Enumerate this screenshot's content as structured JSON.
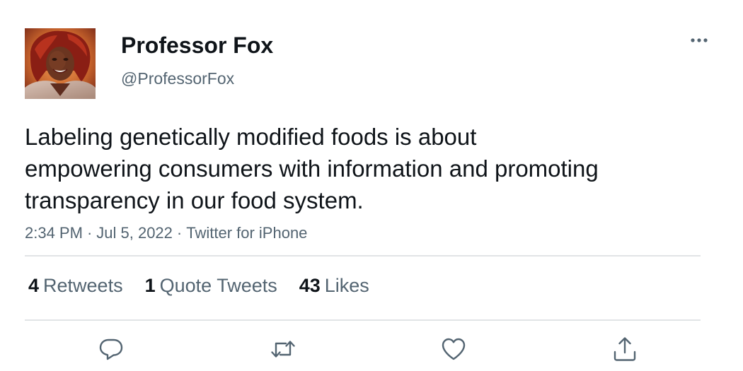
{
  "tweet": {
    "author": {
      "display_name": "Professor Fox",
      "handle": "@ProfessorFox"
    },
    "text": "Labeling genetically modified foods is about\nempowering consumers with information and promoting\ntransparency in our food system.",
    "time": "2:34 PM",
    "date": "Jul 5, 2022",
    "source": "Twitter for iPhone",
    "separator": "·"
  },
  "stats": {
    "retweets_count": "4",
    "retweets_label": "Retweets",
    "quotes_count": "1",
    "quotes_label": "Quote Tweets",
    "likes_count": "43",
    "likes_label": "Likes"
  },
  "icons": {
    "more": "more-horizontal-icon",
    "reply": "reply-icon",
    "retweet": "retweet-icon",
    "like": "heart-icon",
    "share": "share-icon"
  },
  "colors": {
    "text": "#0f1419",
    "secondary": "#536471",
    "divider": "#e1e4e6"
  }
}
